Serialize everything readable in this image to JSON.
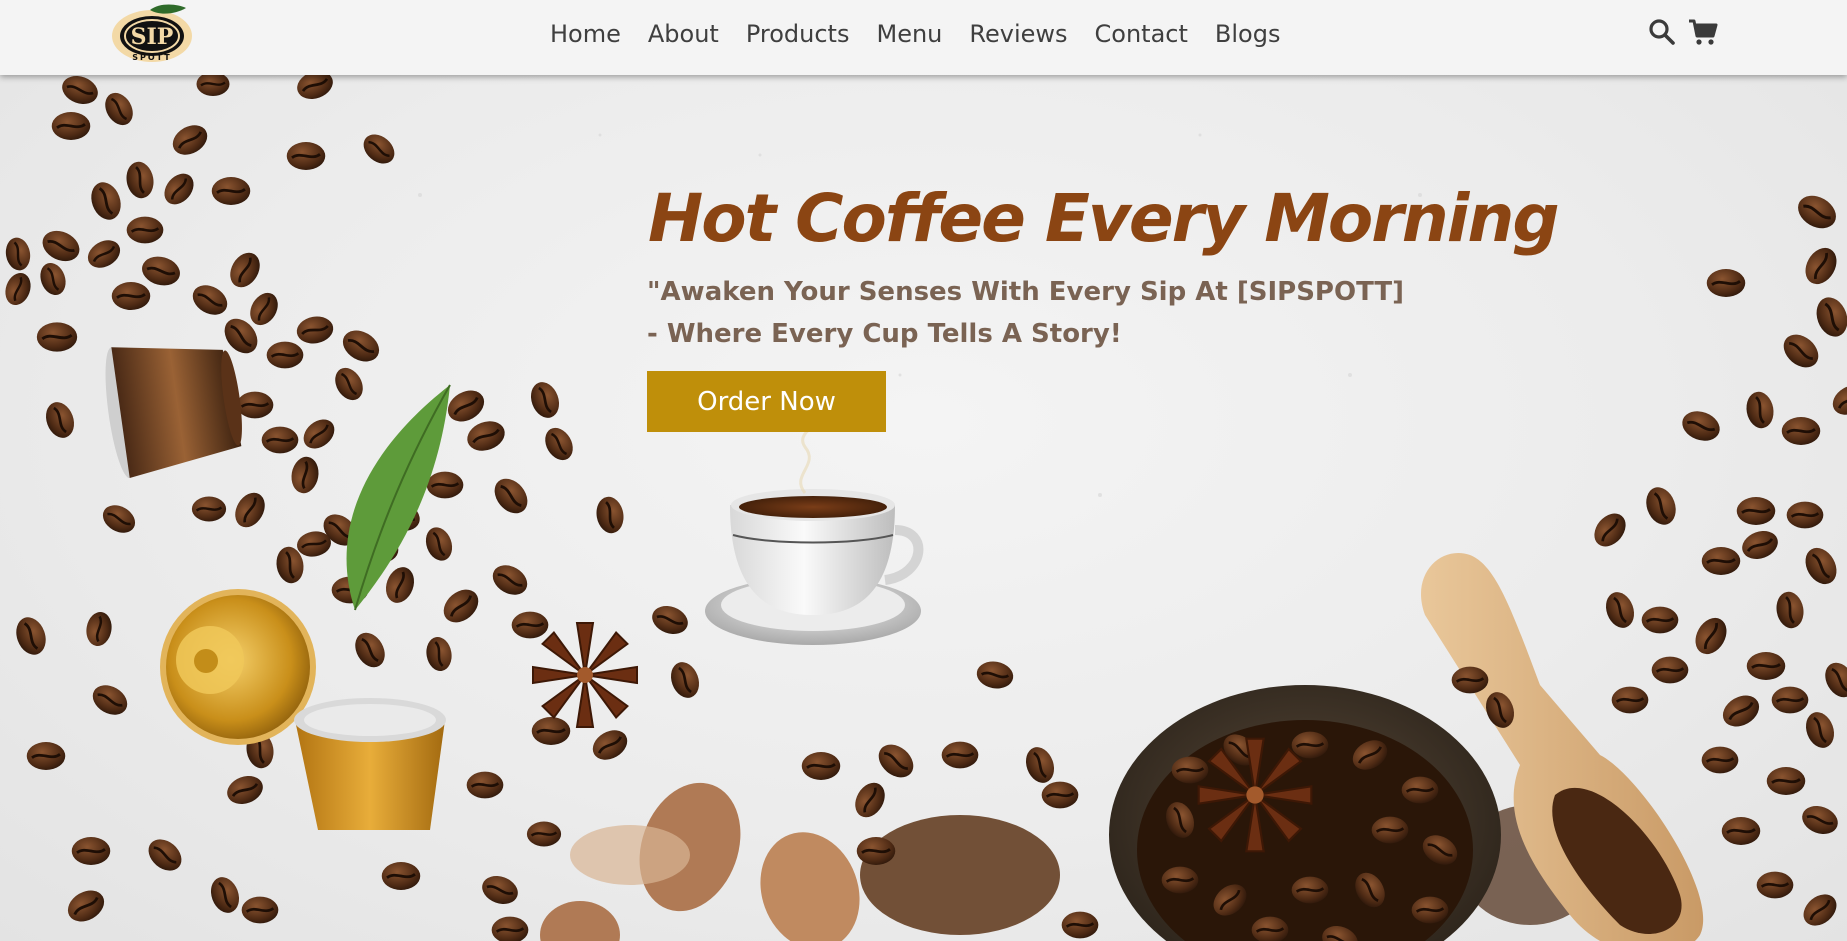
{
  "brand": {
    "logo_text": "SIP",
    "logo_subtext": "SPOTT"
  },
  "nav": {
    "items": [
      {
        "label": "Home"
      },
      {
        "label": "About"
      },
      {
        "label": "Products"
      },
      {
        "label": "Menu"
      },
      {
        "label": "Reviews"
      },
      {
        "label": "Contact"
      },
      {
        "label": "Blogs"
      }
    ]
  },
  "header_icons": {
    "search": "search-icon",
    "cart": "shopping-cart-icon"
  },
  "hero": {
    "title": "Hot Coffee Every Morning",
    "tagline_line1": "\"Awaken Your Senses With Every Sip At [SIPSPOTT]",
    "tagline_line2": "- Where Every Cup Tells A Story!",
    "cta_label": "Order Now"
  },
  "colors": {
    "title": "#8b4513",
    "tagline": "#7a6353",
    "cta_bg": "#bf8f0a",
    "header_bg": "#f4f4f4",
    "nav_text": "#3f3f3f"
  }
}
